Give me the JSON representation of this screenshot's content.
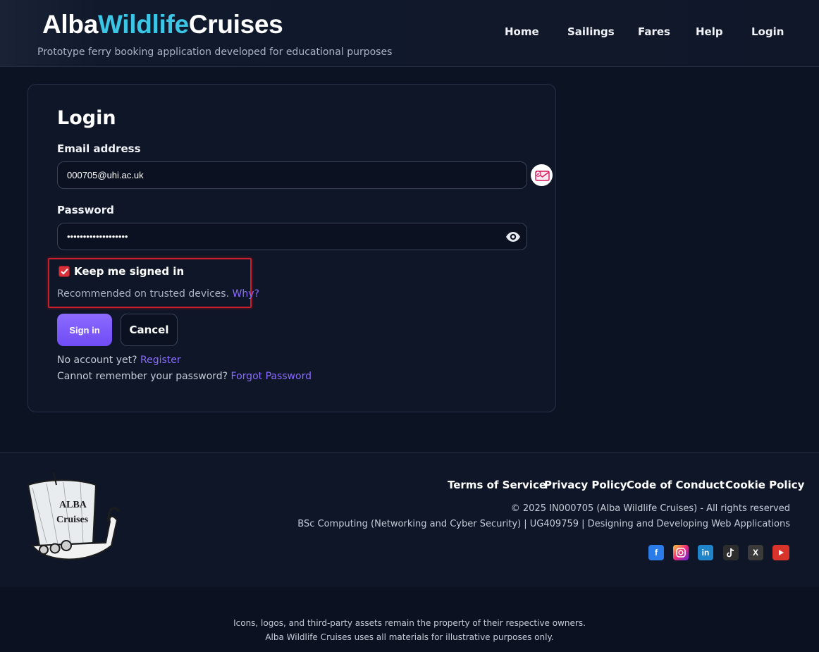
{
  "brand": {
    "part1": "Alba",
    "part2": "Wildlife",
    "part3": "Cruises",
    "tagline": "Prototype ferry booking application developed for educational purposes",
    "accent_color": "#3cc6e6"
  },
  "nav": [
    "Home",
    "Sailings",
    "Fares",
    "Help",
    "Login"
  ],
  "login": {
    "title": "Login",
    "email_label": "Email address",
    "email_value": "000705@uhi.ac.uk",
    "password_label": "Password",
    "password_value": "•••••••••••••••••••",
    "keep_signed_in_label": "Keep me signed in",
    "keep_signed_in_checked": true,
    "recommend_text": "Recommended on trusted devices.",
    "why_link": "Why?",
    "sign_in_button": "Sign in",
    "cancel_button": "Cancel",
    "no_account_text": "No account yet?",
    "register_link": "Register",
    "forgot_text": "Cannot remember your password?",
    "forgot_link": "Forgot Password",
    "primary_color": "#7c5cfc",
    "highlight_color": "#c81f2b"
  },
  "footer": {
    "links": [
      "Terms of Service",
      "Privacy Policy",
      "Code of Conduct",
      "Cookie Policy"
    ],
    "copyright": "© 2025 IN000705 (Alba Wildlife Cruises) - All rights reserved",
    "course": "BSc Computing (Networking and Cyber Security) | UG409759 | Designing and Developing Web Applications",
    "social": [
      "facebook-icon",
      "instagram-icon",
      "linkedin-icon",
      "tiktok-icon",
      "x-icon",
      "youtube-icon"
    ],
    "logo_text": [
      "ALBA",
      "Cruises"
    ],
    "disclaimer_1": "Icons, logos, and third-party assets remain the property of their respective owners.",
    "disclaimer_2": "Alba Wildlife Cruises uses all materials for illustrative purposes only."
  }
}
